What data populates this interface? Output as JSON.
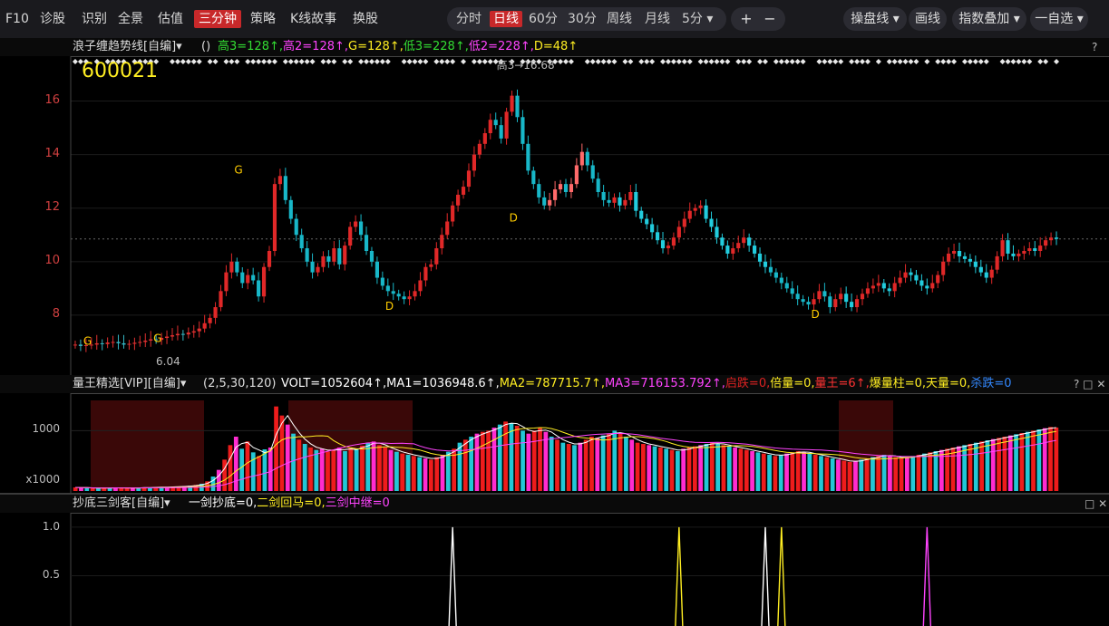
{
  "toolbar": {
    "items": [
      "F10",
      "诊股",
      "识别",
      "全景",
      "估值",
      "三分钟",
      "策略",
      "K线故事",
      "换股"
    ],
    "active_item": "三分钟",
    "periods": [
      "分时",
      "日线",
      "60分",
      "30分",
      "周线",
      "月线",
      "5分 ▾"
    ],
    "active_period": "日线",
    "zoom_in": "+",
    "zoom_out": "−",
    "right_buttons": [
      "操盘线 ▾",
      "画线",
      "指数叠加 ▾",
      "一自选 ▾"
    ],
    "dropdown_icon": "chevron-down-icon"
  },
  "main_panel": {
    "indicator_name": "浪子缠趋势线[自编]▾",
    "params": "()",
    "values": [
      {
        "text": "高3=128↑",
        "color": "#33dd33"
      },
      {
        "text": "高2=128↑",
        "color": "#ff44ff"
      },
      {
        "text": "G=128↑",
        "color": "#ffee22"
      },
      {
        "text": "低3=228↑",
        "color": "#33dd33"
      },
      {
        "text": "低2=228↑",
        "color": "#ff44ff"
      },
      {
        "text": "D=48↑",
        "color": "#ffee22"
      }
    ],
    "stock_code": "600021",
    "y_ticks": [
      "16",
      "14",
      "12",
      "10",
      "8"
    ],
    "high_label": "高3→16.68",
    "low_label": "6.04",
    "price_ref": "10.85"
  },
  "volume_panel": {
    "indicator_name": "量王精选[VIP][自编]▾",
    "params": "(2,5,30,120)",
    "values": [
      {
        "text": "VOLT=1052604↑",
        "color": "#ffffff"
      },
      {
        "text": "MA1=1036948.6↑",
        "color": "#ffffff"
      },
      {
        "text": "MA2=787715.7↑",
        "color": "#ffee22"
      },
      {
        "text": "MA3=716153.792↑",
        "color": "#ff44ff"
      },
      {
        "text": "启跌=0",
        "color": "#dd2222"
      },
      {
        "text": "倍量=0",
        "color": "#ffee22"
      },
      {
        "text": "量王=6↑",
        "color": "#ff3333"
      },
      {
        "text": "爆量柱=0",
        "color": "#ffee22"
      },
      {
        "text": "天量=0",
        "color": "#ffee22"
      },
      {
        "text": "杀跌=0",
        "color": "#3388ff"
      }
    ],
    "y_ticks": [
      "1000",
      "x1000"
    ],
    "controls": "? □ ✕"
  },
  "bottom_panel": {
    "indicator_name": "抄底三剑客[自编]▾",
    "values": [
      {
        "text": "一剑抄底=0",
        "color": "#ffffff"
      },
      {
        "text": "二剑回马=0",
        "color": "#ffee22"
      },
      {
        "text": "三剑中继=0",
        "color": "#ff44ff"
      }
    ],
    "y_ticks": [
      "1.0",
      "0.5"
    ],
    "controls": "□ ✕"
  },
  "chart_data": [
    {
      "type": "candlestick",
      "title": "浪子缠趋势线",
      "ylim": [
        6,
        17
      ],
      "close": [
        6.9,
        6.85,
        6.88,
        6.9,
        6.95,
        6.92,
        6.98,
        7.0,
        6.95,
        6.9,
        6.93,
        6.97,
        7.0,
        7.05,
        7.1,
        7.08,
        7.15,
        7.2,
        7.25,
        7.3,
        7.28,
        7.35,
        7.4,
        7.5,
        7.7,
        7.9,
        8.3,
        8.9,
        9.6,
        10.0,
        9.6,
        9.2,
        9.5,
        9.3,
        8.7,
        9.8,
        10.4,
        12.9,
        13.2,
        12.3,
        11.6,
        11.0,
        10.5,
        10.0,
        9.6,
        9.8,
        10.2,
        10.0,
        10.5,
        9.9,
        10.6,
        11.3,
        11.5,
        11.0,
        10.4,
        10.0,
        9.4,
        9.1,
        8.9,
        8.8,
        8.7,
        8.6,
        8.7,
        8.9,
        9.3,
        9.8,
        9.9,
        10.5,
        11.0,
        11.5,
        12.1,
        12.5,
        12.8,
        13.4,
        14.0,
        14.4,
        14.8,
        15.3,
        15.1,
        14.6,
        15.6,
        16.2,
        15.4,
        14.4,
        13.4,
        12.9,
        12.4,
        12.1,
        12.3,
        12.7,
        12.9,
        12.6,
        12.9,
        13.6,
        14.1,
        13.6,
        13.1,
        12.6,
        12.3,
        12.2,
        12.4,
        12.1,
        12.3,
        12.6,
        11.9,
        11.6,
        11.4,
        11.1,
        10.8,
        10.5,
        10.6,
        10.9,
        11.3,
        11.6,
        11.9,
        12.0,
        12.1,
        11.6,
        11.3,
        10.9,
        10.6,
        10.3,
        10.5,
        10.7,
        10.9,
        10.6,
        10.3,
        10.0,
        9.8,
        9.6,
        9.4,
        9.2,
        9.0,
        8.8,
        8.6,
        8.5,
        8.4,
        8.6,
        8.9,
        8.7,
        8.3,
        8.6,
        8.8,
        8.5,
        8.3,
        8.6,
        8.8,
        9.0,
        9.1,
        9.2,
        9.0,
        8.9,
        9.2,
        9.4,
        9.6,
        9.5,
        9.3,
        9.1,
        9.0,
        9.2,
        9.5,
        10.0,
        10.3,
        10.4,
        10.2,
        10.1,
        10.0,
        9.8,
        9.6,
        9.4,
        9.7,
        10.2,
        10.8,
        10.3,
        10.2,
        10.3,
        10.4,
        10.5,
        10.4,
        10.6,
        10.8,
        10.9,
        10.85
      ],
      "x_label": "日线",
      "series_markers": [
        "G",
        "D",
        "眼",
        "↑",
        "↓"
      ]
    },
    {
      "type": "bar",
      "title": "量王精选",
      "values_k": [
        60,
        55,
        50,
        48,
        45,
        50,
        52,
        55,
        50,
        48,
        52,
        55,
        58,
        60,
        62,
        65,
        68,
        70,
        75,
        80,
        90,
        100,
        120,
        160,
        240,
        350,
        520,
        760,
        900,
        700,
        820,
        640,
        580,
        690,
        720,
        1400,
        1250,
        1100,
        950,
        850,
        780,
        720,
        680,
        700,
        650,
        680,
        720,
        660,
        710,
        690,
        750,
        800,
        820,
        760,
        720,
        680,
        650,
        620,
        600,
        580,
        560,
        540,
        520,
        560,
        600,
        650,
        700,
        800,
        850,
        900,
        950,
        980,
        1000,
        1050,
        1100,
        1150,
        1120,
        1080,
        1000,
        950,
        1000,
        1050,
        980,
        900,
        850,
        800,
        780,
        760,
        800,
        850,
        900,
        880,
        920,
        950,
        1000,
        950,
        900,
        850,
        800,
        780,
        760,
        740,
        720,
        700,
        680,
        660,
        700,
        720,
        740,
        760,
        780,
        800,
        780,
        760,
        740,
        720,
        700,
        680,
        660,
        640,
        620,
        600,
        580,
        600,
        620,
        640,
        660,
        640,
        620,
        600,
        580,
        560,
        540,
        520,
        500,
        480,
        500,
        520,
        540,
        560,
        580,
        600,
        580,
        560,
        540,
        560,
        580,
        600,
        620,
        640,
        660,
        680,
        700,
        720,
        740,
        760,
        780,
        800,
        820,
        840,
        860,
        880,
        900,
        920,
        940,
        960,
        980,
        1000,
        1020,
        1040,
        1060,
        1052
      ],
      "ma_lines": [
        "MA1",
        "MA2",
        "MA3"
      ]
    },
    {
      "type": "line",
      "title": "抄底三剑客",
      "ylim": [
        0,
        1.0
      ],
      "spikes": [
        {
          "name": "一剑抄底",
          "color": "#ffffff",
          "x_index": [
            70,
            128
          ]
        },
        {
          "name": "二剑回马",
          "color": "#ffee22",
          "x_index": [
            112,
            131
          ]
        },
        {
          "name": "三剑中继",
          "color": "#ff44ff",
          "x_index": [
            158
          ]
        }
      ]
    }
  ]
}
